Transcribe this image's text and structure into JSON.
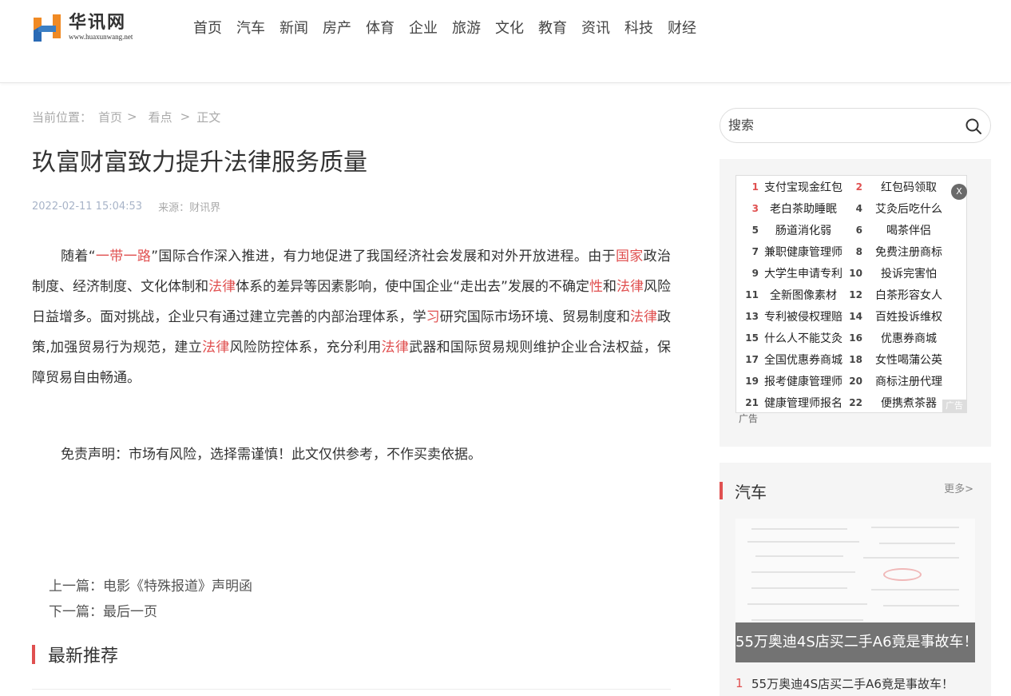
{
  "header": {
    "logo_cn": "华讯网",
    "logo_url": "www.huaxunwang.net",
    "nav": [
      "首页",
      "汽车",
      "新闻",
      "房产",
      "体育",
      "企业",
      "旅游",
      "文化",
      "教育",
      "资讯",
      "科技",
      "财经"
    ]
  },
  "breadcrumb": {
    "label": "当前位置：",
    "home": "首页",
    "sep": ">",
    "section": "看点",
    "current": "正文"
  },
  "article": {
    "title": "玖富财富致力提升法律服务质量",
    "date": "2022-02-11 15:04:53",
    "source": "来源：财讯界",
    "paragraph": [
      {
        "t": "随着“",
        "hl": false
      },
      {
        "t": "一带一路",
        "hl": true
      },
      {
        "t": "”国际合作深入推进，有力地促进了我国经济社会发展和对外开放进程。由于",
        "hl": false
      },
      {
        "t": "国家",
        "hl": true
      },
      {
        "t": "政治制度、经济制度、文化体制和",
        "hl": false
      },
      {
        "t": "法律",
        "hl": true
      },
      {
        "t": "体系的差异等因素影响，使中国企业“走出去”发展的不确定",
        "hl": false
      },
      {
        "t": "性",
        "hl": true
      },
      {
        "t": "和",
        "hl": false
      },
      {
        "t": "法律",
        "hl": true
      },
      {
        "t": "风险日益增多。面对挑战，企业只有通过建立完善的内部治理体系，学",
        "hl": false
      },
      {
        "t": "习",
        "hl": true
      },
      {
        "t": "研究国际市场环境、贸易制度和",
        "hl": false
      },
      {
        "t": "法律",
        "hl": true
      },
      {
        "t": "政策,加强贸易行为规范，建立",
        "hl": false
      },
      {
        "t": "法律",
        "hl": true
      },
      {
        "t": "风险防控体系，充分利用",
        "hl": false
      },
      {
        "t": "法律",
        "hl": true
      },
      {
        "t": "武器和国际贸易规则维护企业合法权益，保障贸易自由畅通。",
        "hl": false
      }
    ],
    "disclaimer": "免责声明：市场有风险，选择需谨慎！此文仅供参考，不作买卖依据。",
    "prev_label": "上一篇：",
    "prev_title": "电影《特殊报道》声明函",
    "next_label": "下一篇：",
    "next_title": "最后一页"
  },
  "latest": {
    "heading": "最新推荐"
  },
  "sidebar": {
    "search_placeholder": "搜索",
    "ads": [
      [
        "1",
        "支付宝现金红包",
        "2",
        "红包码领取"
      ],
      [
        "3",
        "老白茶助睡眠",
        "4",
        "艾灸后吃什么"
      ],
      [
        "5",
        "肠道消化弱",
        "6",
        "喝茶伴侣"
      ],
      [
        "7",
        "兼职健康管理师",
        "8",
        "免费注册商标"
      ],
      [
        "9",
        "大学生申请专利",
        "10",
        "投诉完害怕"
      ],
      [
        "11",
        "全新图像素材",
        "12",
        "白茶形容女人"
      ],
      [
        "13",
        "专利被侵权理赔",
        "14",
        "百姓投诉维权"
      ],
      [
        "15",
        "什么人不能艾灸",
        "16",
        "优惠券商城"
      ],
      [
        "17",
        "全国优惠券商城",
        "18",
        "女性喝蒲公英"
      ],
      [
        "19",
        "报考健康管理师",
        "20",
        "商标注册代理"
      ],
      [
        "21",
        "健康管理师报名",
        "22",
        "便携煮茶器"
      ]
    ],
    "ad_close": "X",
    "ad_tag": "广告",
    "ad_label": "广告",
    "car": {
      "heading": "汽车",
      "more": "更多>",
      "caption": "55万奥迪4S店买二手A6竟是事故车！",
      "list": [
        {
          "n": "1",
          "t": "55万奥迪4S店买二手A6竟是事故车！"
        }
      ]
    }
  },
  "colors": {
    "accent": "#e05050",
    "meta_date": "#a8b4c8",
    "panel_bg": "#f5f5f5"
  }
}
